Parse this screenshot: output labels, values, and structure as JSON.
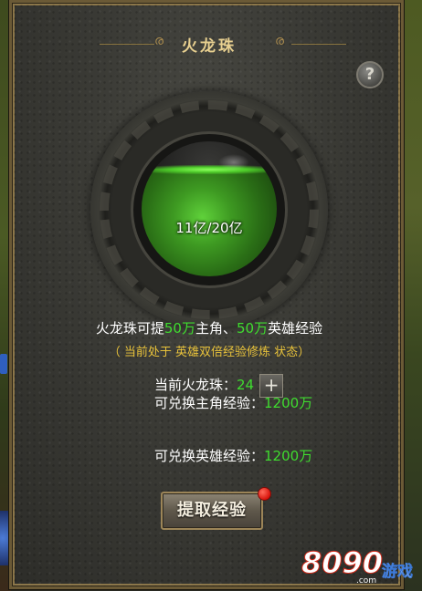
{
  "window": {
    "title": "火龙珠"
  },
  "help": {
    "label": "?"
  },
  "orb": {
    "current": "11亿",
    "max": "20亿",
    "text": "11亿/20亿",
    "fill_fraction": 0.55
  },
  "info": {
    "line1_prefix": "火龙珠可提",
    "hero_main_amount": "50万",
    "line1_mid": "主角、",
    "hero_amount": "50万",
    "line1_suffix": "英雄经验",
    "status_open": "（ 当前处于 ",
    "status_state": "英雄双倍经验修炼 状态",
    "status_close": "）"
  },
  "count": {
    "label": "当前火龙珠：",
    "value": "24",
    "add_label": "+"
  },
  "exchange": [
    {
      "label": "可兑换主角经验：",
      "value": "1200万"
    },
    {
      "label": "可兑换英雄经验：",
      "value": "1200万"
    }
  ],
  "extract_button": {
    "label": "提取经验"
  },
  "watermark": {
    "number": "8090",
    "game": "游戏",
    "domain": ".com"
  },
  "colors": {
    "green": "#3fdc2f",
    "yellow": "#f1c232",
    "title": "#e8d090"
  }
}
